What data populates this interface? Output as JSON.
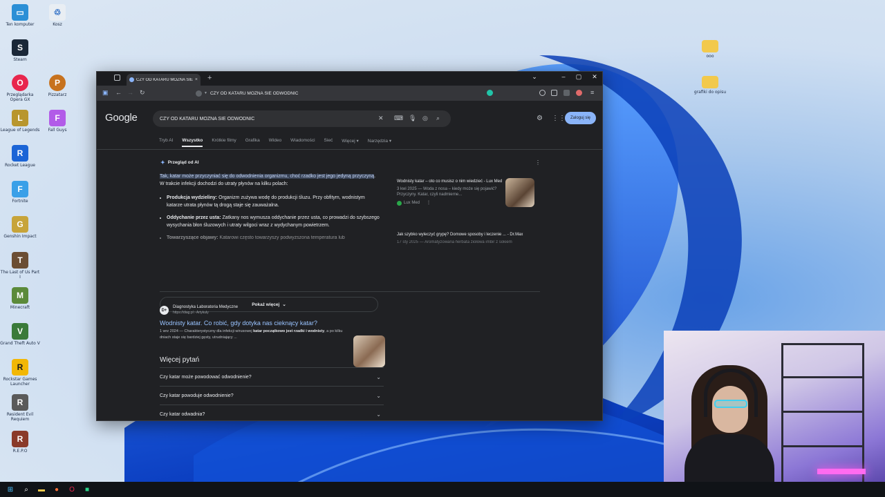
{
  "desktop": {
    "icons": [
      {
        "label": "Ten komputer",
        "color": "#2b8fd6",
        "glyph": "▭"
      },
      {
        "label": "Kosz",
        "color": "#e9eef3",
        "glyph": "♲"
      },
      {
        "label": "Steam",
        "color": "#1b2838",
        "glyph": "S"
      },
      {
        "label": "Przeglądarka Opera GX",
        "color": "#e8264d",
        "glyph": "O"
      },
      {
        "label": "Pizzatarz",
        "color": "#c7721e",
        "glyph": "P"
      },
      {
        "label": "League of Legends",
        "color": "#b8962e",
        "glyph": "L"
      },
      {
        "label": "Fall Guys",
        "color": "#b25be8",
        "glyph": "F"
      },
      {
        "label": "Rocket League",
        "color": "#1b64d6",
        "glyph": "R"
      },
      {
        "label": "Fortnite",
        "color": "#3aa0e8",
        "glyph": "F"
      },
      {
        "label": "Genshin Impact",
        "color": "#c7a43a",
        "glyph": "G"
      },
      {
        "label": "The Last of Us Part I",
        "color": "#6b4e34",
        "glyph": "T"
      },
      {
        "label": "Minecraft",
        "color": "#5b8a3a",
        "glyph": "M"
      },
      {
        "label": "Grand Theft Auto V",
        "color": "#3a7a3a",
        "glyph": "V"
      },
      {
        "label": "Rockstar Games Launcher",
        "color": "#f2b705",
        "glyph": "R"
      },
      {
        "label": "Resident Evil Requiem",
        "color": "#5a5a5a",
        "glyph": "R"
      },
      {
        "label": "R.E.P.O",
        "color": "#8a3a2a",
        "glyph": "R"
      },
      {
        "label": "ooo",
        "color": "#f2c94c",
        "glyph": "▬"
      },
      {
        "label": "grafiki do opisu",
        "color": "#f2c94c",
        "glyph": "▬"
      }
    ]
  },
  "browser": {
    "tab_title": "CZY OD KATARU MOZNA SIE ODWODNIC",
    "tab_close": "×",
    "new_tab": "+",
    "url": "CZY OD KATARU MOZNA SIE ODWODNIC",
    "controls": {
      "dropdown": "⌄",
      "minimize": "–",
      "maximize": "▢",
      "close": "✕"
    },
    "nav": {
      "back": "←",
      "forward": "→",
      "reload": "↻",
      "menu": "≡"
    }
  },
  "google": {
    "logo": "Google",
    "query": "CZY OD KATARU MOZNA SIE ODWODNIC",
    "signin_label": "Zaloguj się",
    "filters": [
      "Tryb AI",
      "Wszystko",
      "Krótkie filmy",
      "Grafika",
      "Wideo",
      "Wiadomości",
      "Sieć",
      "Więcej ▾",
      "Narzędzia ▾"
    ],
    "ai_overview": {
      "title": "Przegląd od AI",
      "highlighted": "Tak, katar może przyczyniać się do odwodnienia organizmu, choć rzadko jest jego jedyną przyczyną",
      "intro_rest": ". W trakcie infekcji dochodzi do utraty płynów na kilku polach:",
      "bullets": [
        {
          "head": "Produkcja wydzieliny:",
          "text": " Organizm zużywa wodę do produkcji śluzu. Przy obfitym, wodnistym katarze utrata płynów tą drogą staje się zauważalna."
        },
        {
          "head": "Oddychanie przez usta:",
          "text": " Zatkany nos wymusza oddychanie przez usta, co prowadzi do szybszego wysychania błon śluzowych i utraty wilgoci wraz z wydychanym powietrzem."
        },
        {
          "head": "Towarzyszące objawy:",
          "text": " Katarowi często towarzyszy podwyższona temperatura lub"
        }
      ],
      "show_more": "Pokaż więcej",
      "sources": [
        {
          "title": "Wodnisty katar – oto co musisz o nim wiedzieć - Lux Med",
          "snippet": "3 kwi 2025 — Woda z nosa – kiedy może się pojawić? Przyczyny. Katar, czyli nadmierne...",
          "site": "Lux Med"
        },
        {
          "title": "Jak szybko wyleczyć grypę? Domowe sposoby i leczenie ... - Dr.Max",
          "snippet": "17 sty 2025 — Aromatyzowana herbata ziołowa imbir z sokiem"
        }
      ]
    },
    "result": {
      "favicon": "D+",
      "site": "Diagnostyka Laboratoria Medyczne",
      "url": "https://diag.pl › Artykuły",
      "title": "Wodnisty katar. Co robić, gdy dotyka nas cieknący katar?",
      "snippet_date": "1 wrz 2024 —",
      "snippet": " Charakterystyczny dla infekcji wirusowej ",
      "snippet_bold": "katar początkowo jest rzadki i wodnisty",
      "snippet_end": ", a po kilku dniach staje się bardziej gęsty, utrudniający ..."
    },
    "paa": {
      "title": "Więcej pytań",
      "questions": [
        "Czy katar może powodować odwodnienie?",
        "Czy katar powoduje odwodnienie?",
        "Czy katar odwadnia?"
      ]
    }
  },
  "taskbar": {
    "items": [
      {
        "name": "start-icon",
        "glyph": "⊞",
        "color": "#4cc2ff"
      },
      {
        "name": "search-icon",
        "glyph": "⌕",
        "color": "#ffffff"
      },
      {
        "name": "file-explorer-icon",
        "glyph": "▬",
        "color": "#f2c94c"
      },
      {
        "name": "firefox-icon",
        "glyph": "●",
        "color": "#ff7139"
      },
      {
        "name": "opera-gx-icon",
        "glyph": "O",
        "color": "#e8264d"
      },
      {
        "name": "app-icon",
        "glyph": "■",
        "color": "#2bd48a"
      }
    ]
  }
}
